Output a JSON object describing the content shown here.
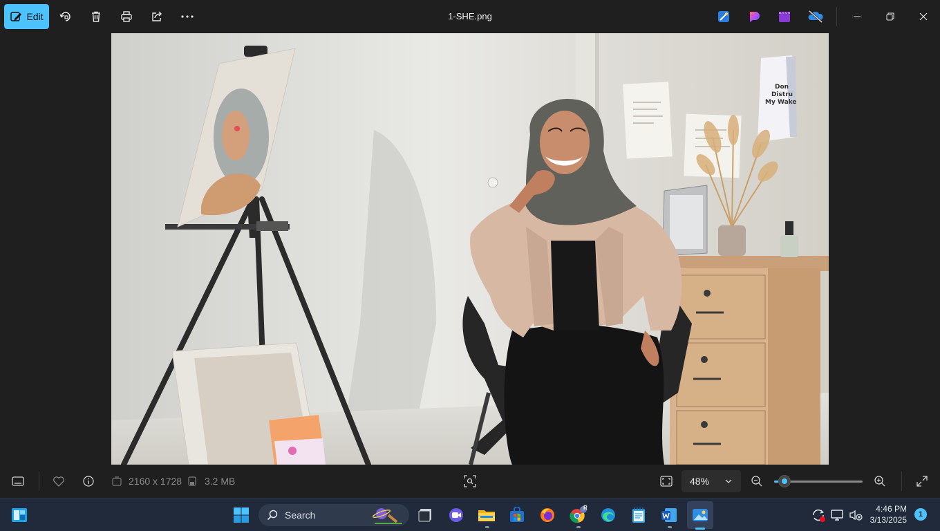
{
  "toolbar": {
    "edit_label": "Edit",
    "file_name": "1-SHE.png"
  },
  "photo": {
    "poster_text": [
      "Don",
      "Distru",
      "My Wake"
    ]
  },
  "status": {
    "dimensions": "2160 x 1728",
    "file_size": "3.2 MB",
    "zoom": "48%",
    "zoom_level_fraction": 0.12
  },
  "taskbar": {
    "search_placeholder": "Search",
    "chrome_profile_badge": "R",
    "time": "4:46 PM",
    "date": "3/13/2025",
    "notification_count": "1"
  },
  "colors": {
    "accent": "#4cc2ff",
    "app_bg": "#1f1f1f",
    "taskbar_bg": "#202a3a"
  }
}
